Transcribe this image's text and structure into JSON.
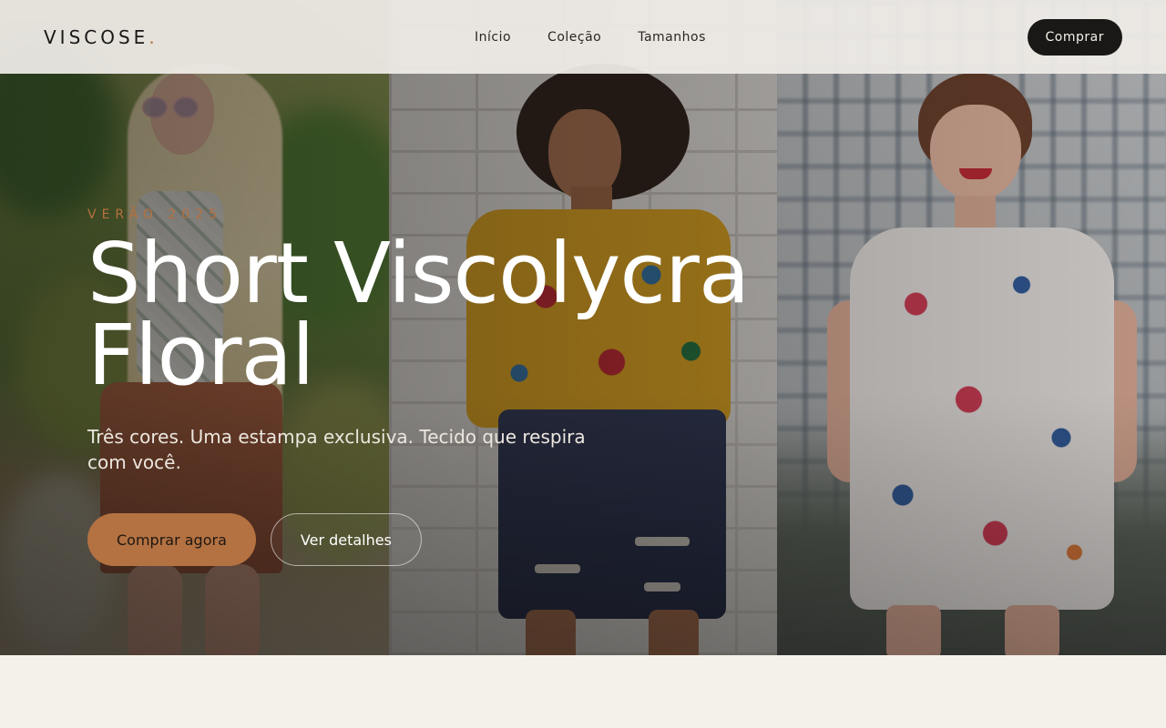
{
  "header": {
    "logo": "VISCOSE",
    "logo_dot": ".",
    "nav": [
      "Início",
      "Coleção",
      "Tamanhos"
    ],
    "cta_label": "Comprar"
  },
  "hero": {
    "eyebrow": "VERÃO 2025",
    "headline_line1": "Short Viscolycra",
    "headline_line2": "Floral",
    "subtitle": "Três cores. Uma estampa exclusiva. Tecido que respira com você.",
    "primary_button": "Comprar agora",
    "secondary_button": "Ver detalhes"
  },
  "colors": {
    "accent": "#b47242",
    "dark": "#1a1816",
    "background": "#f4f1ea"
  }
}
